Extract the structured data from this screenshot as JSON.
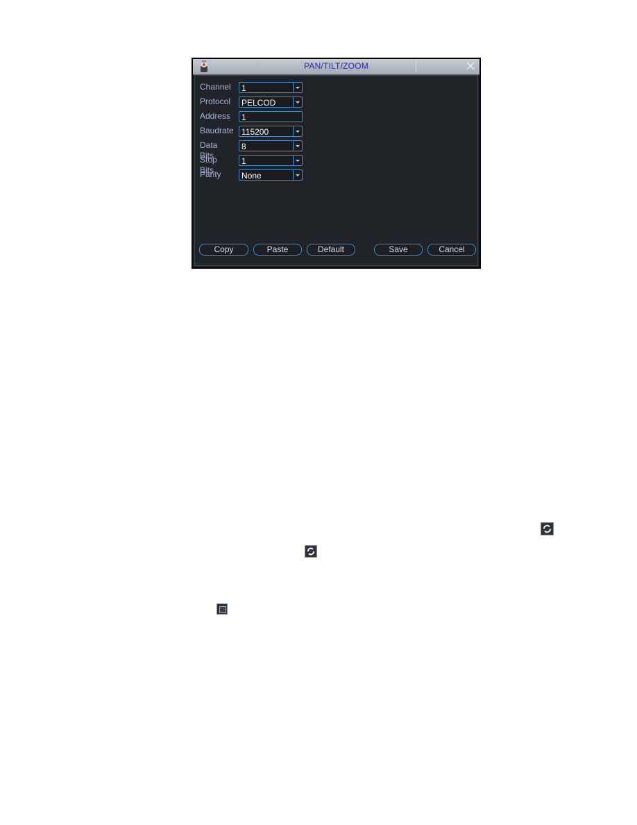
{
  "dialog": {
    "title": "PAN/TILT/ZOOM",
    "icons": {
      "app": "ptz-camera-icon",
      "close": "close-icon"
    }
  },
  "fields": [
    {
      "label": "Channel",
      "value": "1",
      "type": "dropdown"
    },
    {
      "label": "Protocol",
      "value": "PELCOD",
      "type": "dropdown"
    },
    {
      "label": "Address",
      "value": "1",
      "type": "text"
    },
    {
      "label": "Baudrate",
      "value": "115200",
      "type": "dropdown"
    },
    {
      "label": "Data Bits",
      "value": "8",
      "type": "dropdown"
    },
    {
      "label": "Stop Bits",
      "value": "1",
      "type": "dropdown"
    },
    {
      "label": "Parity",
      "value": "None",
      "type": "dropdown"
    }
  ],
  "buttons": {
    "copy": "Copy",
    "paste": "Paste",
    "default": "Default",
    "save": "Save",
    "cancel": "Cancel"
  },
  "page_icons": [
    "refresh-icon",
    "refresh-icon",
    "stop-square-icon"
  ],
  "colors": {
    "title_text": "#1e2ab0",
    "label_text": "#a9b4da",
    "border_accent": "#4f8ec8",
    "background": "#202327"
  }
}
